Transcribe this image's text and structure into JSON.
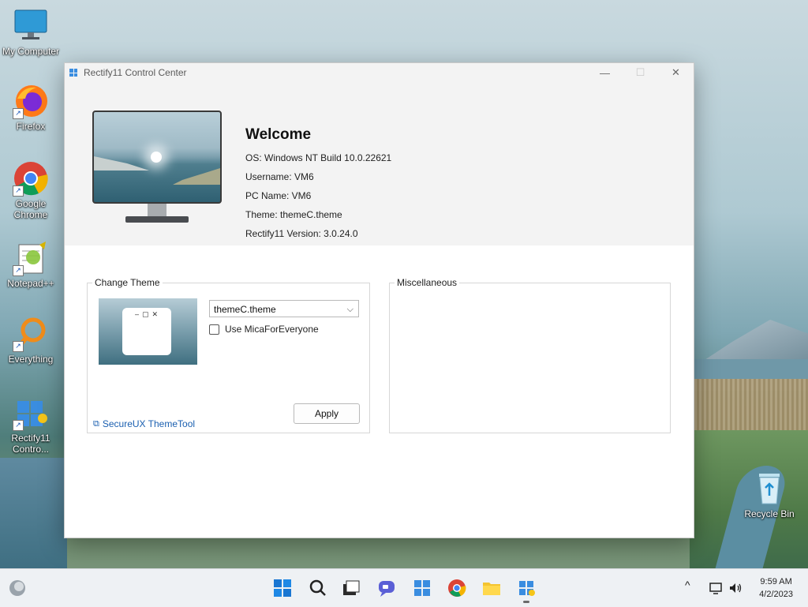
{
  "desktop": {
    "icons": [
      {
        "label": "My Computer"
      },
      {
        "label": "Firefox"
      },
      {
        "label": "Google Chrome"
      },
      {
        "label": "Notepad++"
      },
      {
        "label": "Everything"
      },
      {
        "label": "Rectify11 Contro..."
      },
      {
        "label": "Recycle Bin"
      }
    ]
  },
  "window": {
    "title": "Rectify11 Control Center",
    "controls": {
      "minimize": "—",
      "maximize": "☐",
      "close": "✕"
    },
    "welcome": {
      "heading": "Welcome",
      "os": "OS: Windows NT Build 10.0.22621",
      "username": "Username: VM6",
      "pc_name": "PC Name: VM6",
      "theme": "Theme: themeC.theme",
      "version": "Rectify11 Version: 3.0.24.0"
    },
    "change_theme": {
      "title": "Change Theme",
      "selected_theme": "themeC.theme",
      "mica_label": "Use MicaForEveryone",
      "mica_checked": false,
      "apply_label": "Apply",
      "link_label": "SecureUX ThemeTool"
    },
    "misc": {
      "title": "Miscellaneous"
    }
  },
  "taskbar": {
    "time": "9:59 AM",
    "date": "4/2/2023",
    "tray_up": "^"
  },
  "colors": {
    "accent": "#1a5fb0",
    "windows_blue": "#3a8de0"
  }
}
